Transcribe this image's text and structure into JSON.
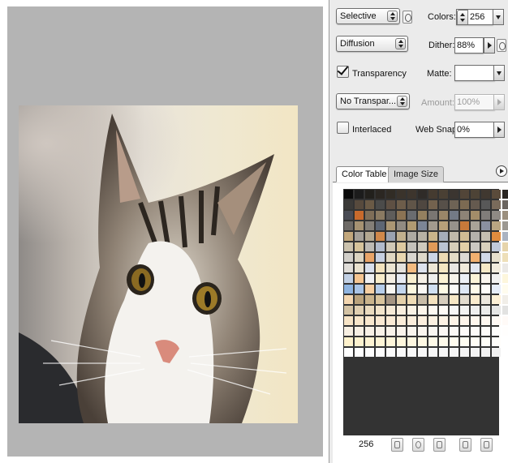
{
  "preview": {
    "image_alt": "tabby cat face photo"
  },
  "settings": {
    "reduction": "Selective",
    "dither_algorithm": "Diffusion",
    "transparency_dither": "No Transpar...",
    "colors_label": "Colors:",
    "colors_value": "256",
    "dither_label": "Dither:",
    "dither_value": "88%",
    "transparency_label": "Transparency",
    "transparency_checked": true,
    "matte_label": "Matte:",
    "matte_value": "",
    "amount_label": "Amount:",
    "amount_value": "100%",
    "interlaced_label": "Interlaced",
    "interlaced_checked": false,
    "websnap_label": "Web Snap:",
    "websnap_value": "0%"
  },
  "tabs": [
    {
      "label": "Color Table",
      "active": true
    },
    {
      "label": "Image Size",
      "active": false
    }
  ],
  "color_table": {
    "count": "256",
    "columns": 16,
    "swatches": [
      "#0a0a0a",
      "#1c1c1c",
      "#22201c",
      "#2b2722",
      "#312c25",
      "#3a332b",
      "#3d352d",
      "#2f2b28",
      "#453b30",
      "#4a4034",
      "#3b3530",
      "#524538",
      "#4d4336",
      "#403830",
      "#5a4b3b",
      "#2a2622",
      "#3b3a38",
      "#574a3d",
      "#6a5a46",
      "#4b4b4a",
      "#5e5043",
      "#6d5d4a",
      "#605548",
      "#4f4740",
      "#73624e",
      "#575049",
      "#6e6355",
      "#7c6a52",
      "#655a4f",
      "#585858",
      "#7a6b5b",
      "#6b6560",
      "#4a4c55",
      "#c86a2c",
      "#7f6e58",
      "#8a7a62",
      "#5f5d5b",
      "#8b7354",
      "#6a6c70",
      "#94805f",
      "#7a7672",
      "#9a8668",
      "#737a86",
      "#8d8377",
      "#a38d69",
      "#807d7a",
      "#8f8a84",
      "#9b8f7d",
      "#6e6a66",
      "#a69272",
      "#847f78",
      "#5d6674",
      "#aa9674",
      "#918b82",
      "#b09a72",
      "#7c8596",
      "#a29a8e",
      "#b7a07a",
      "#96928b",
      "#c8793a",
      "#a9a398",
      "#8a90a0",
      "#b9a682",
      "#9c9891",
      "#c2a77c",
      "#a6a199",
      "#b3a891",
      "#d0884a",
      "#9aa2b0",
      "#c1b08e",
      "#aeaaa2",
      "#b8b2a5",
      "#c9b48a",
      "#a5adbb",
      "#bfb8aa",
      "#d1bd94",
      "#b4b1ab",
      "#c4beb0",
      "#e08c3e",
      "#aab3c2",
      "#cbc2ad",
      "#d6c39b",
      "#bdbab4",
      "#b1bacb",
      "#d0c8b6",
      "#ddc9a0",
      "#c4c1bb",
      "#cec9bd",
      "#e09a58",
      "#bac3d2",
      "#d5cdb9",
      "#e2cfa7",
      "#cbc8c2",
      "#d8d0bc",
      "#c0c9da",
      "#e6d4ab",
      "#d2cfc9",
      "#dbd3c0",
      "#e8a468",
      "#c6cfe0",
      "#e0d7c2",
      "#e9d7b0",
      "#d8d5cf",
      "#ded8ca",
      "#ccd5e5",
      "#ecdab4",
      "#e3dbc6",
      "#dcd9d4",
      "#f0b070",
      "#d2dae8",
      "#e6dfcc",
      "#eedfb9",
      "#e0ddd8",
      "#e9e1ce",
      "#d8dfec",
      "#f2e2bd",
      "#ebe4d2",
      "#e4e2dd",
      "#f4bb80",
      "#dde3ef",
      "#eee7d6",
      "#f4e6c2",
      "#e8e6e2",
      "#f0eadb",
      "#e2e7f1",
      "#f6e9c6",
      "#f2ecde",
      "#ebe9e6",
      "#c2d0e4",
      "#f5c591",
      "#eff0f2",
      "#f8ecca",
      "#f4eee2",
      "#e7ebf3",
      "#f9efcf",
      "#f6f1e7",
      "#eeeeed",
      "#fbf2d3",
      "#f7f3ea",
      "#ecf0f6",
      "#fcf4d8",
      "#f9f5ee",
      "#f1f1f0",
      "#fdf6dc",
      "#8fb4e0",
      "#a9c4e6",
      "#f6cfa2",
      "#b6cdea",
      "#f9f7f2",
      "#c3d6ee",
      "#fdf8e0",
      "#fbf9f5",
      "#d0dff2",
      "#fefae5",
      "#fcfbf8",
      "#dde7f5",
      "#fffbea",
      "#fdfcfa",
      "#e6edf8",
      "#fffcee",
      "#f3d6b0",
      "#b9a27c",
      "#c9b38c",
      "#d8c39c",
      "#a59583",
      "#e4d0aa",
      "#efdcb6",
      "#c8bca8",
      "#f4e2bf",
      "#d7cdbd",
      "#f8e8c6",
      "#e3dccf",
      "#fbecce",
      "#ebe6dd",
      "#fdf0d6",
      "#f1eee8",
      "#d4c3a4",
      "#e0cfb1",
      "#eadbbf",
      "#f2e4cb",
      "#f6ead6",
      "#f9efdf",
      "#fbf3e6",
      "#fdf6ec",
      "#fef9f2",
      "#fffbf6",
      "#f8f8f8",
      "#f4f4f3",
      "#efefee",
      "#ebebea",
      "#e6e6e5",
      "#e2e2e1",
      "#f7e4c6",
      "#f8e6ca",
      "#f9e8ce",
      "#fae9d2",
      "#fbebd5",
      "#fbedd9",
      "#fceedc",
      "#fdf0df",
      "#fdf1e2",
      "#fef3e5",
      "#fef4e8",
      "#fef5eb",
      "#fff7ee",
      "#fff8f1",
      "#fff9f4",
      "#fffaf7",
      "#f7efe2",
      "#f8f0e4",
      "#f8f1e6",
      "#f9f2e8",
      "#f9f3ea",
      "#faf4ec",
      "#faf5ee",
      "#fbf6f0",
      "#fbf7f2",
      "#fcf8f4",
      "#fcf9f6",
      "#fdfaf8",
      "#fdfbf9",
      "#fefcfa",
      "#fefdfc",
      "#fffefd",
      "#fff2cc",
      "#fff3cf",
      "#fff4d3",
      "#fff5d6",
      "#fff6da",
      "#fff7dd",
      "#fff8e1",
      "#fff9e4",
      "#fffae8",
      "#fffbeb",
      "#fffcef",
      "#fffdf2",
      "#fffdf5",
      "#fffef8",
      "#fffefb",
      "#ffffff",
      "#ffffff",
      "#fefefe",
      "#fdfdfd",
      "#fcfcfc",
      "#fbfbfb",
      "#fafafa",
      "#f9f9f9",
      "#f8f8f8",
      "#f7f7f7",
      "#f6f6f6",
      "#f5f5f5",
      "#f4f4f4",
      "#f3f3f3",
      "#f2f2f2",
      "#f1f1f1",
      "#ffffff"
    ]
  },
  "toolbar_icons": [
    "map-to-transparent-icon",
    "web-shift-icon",
    "lock-color-icon",
    "new-color-icon",
    "trash-icon"
  ]
}
